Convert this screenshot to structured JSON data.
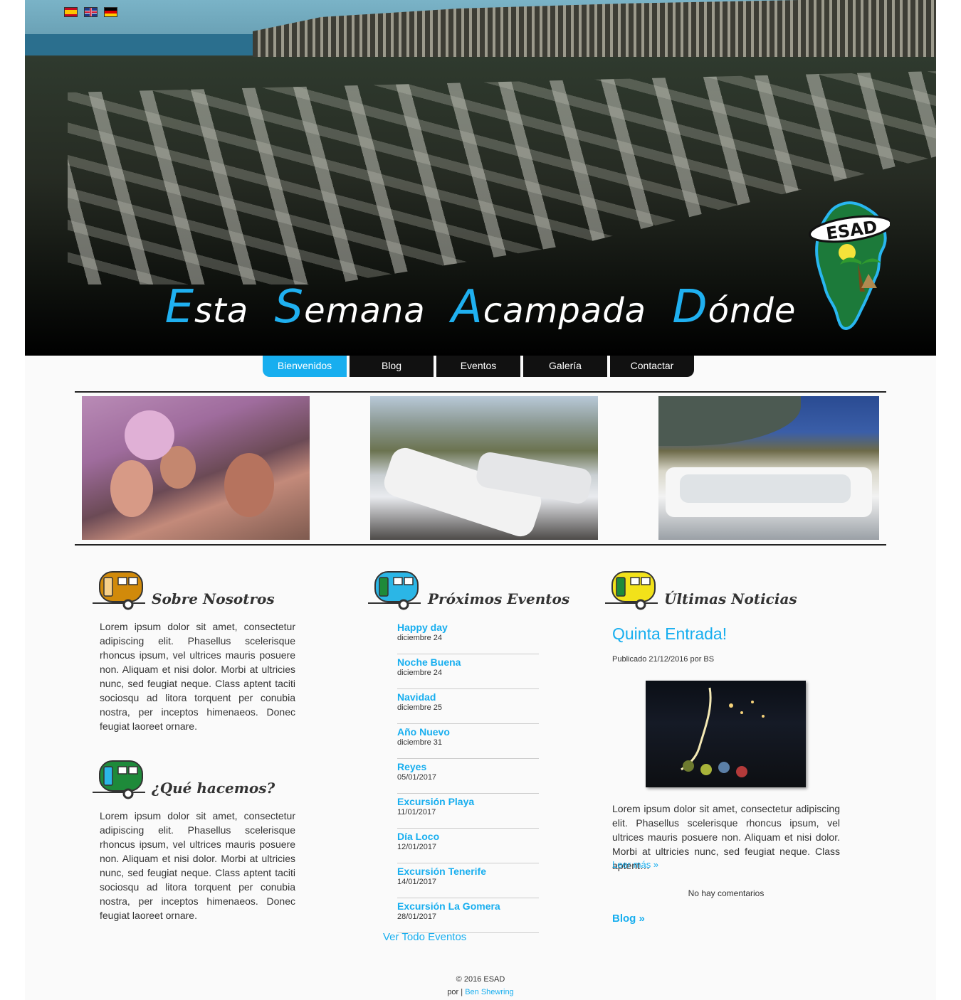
{
  "header": {
    "title_words": [
      {
        "cap": "E",
        "rest": "sta"
      },
      {
        "cap": "S",
        "rest": "emana"
      },
      {
        "cap": "A",
        "rest": "campada"
      },
      {
        "cap": "D",
        "rest": "ónde"
      }
    ],
    "logo_text": "ESAD",
    "languages": [
      "es-flag-icon",
      "gb-flag-icon",
      "de-flag-icon"
    ]
  },
  "nav": {
    "items": [
      "Bienvenidos",
      "Blog",
      "Eventos",
      "Galería",
      "Contactar"
    ],
    "active": "Bienvenidos"
  },
  "about": {
    "title": "Sobre Nosotros",
    "text": "Lorem ipsum dolor sit amet, consectetur adipiscing elit. Phasellus scelerisque rhoncus ipsum, vel ultrices mauris posuere non. Aliquam et nisi dolor. Morbi at ultricies nunc, sed feugiat neque. Class aptent taciti sociosqu ad litora torquent per conubia nostra, per inceptos himenaeos. Donec feugiat laoreet ornare."
  },
  "what": {
    "title": "¿Qué hacemos?",
    "text": "Lorem ipsum dolor sit amet, consectetur adipiscing elit. Phasellus scelerisque rhoncus ipsum, vel ultrices mauris posuere non. Aliquam et nisi dolor. Morbi at ultricies nunc, sed feugiat neque. Class aptent taciti sociosqu ad litora torquent per conubia nostra, per inceptos himenaeos. Donec feugiat laoreet ornare."
  },
  "events": {
    "title": "Próximos Eventos",
    "items": [
      {
        "title": "Happy day",
        "date": "diciembre 24"
      },
      {
        "title": "Noche Buena",
        "date": "diciembre 24"
      },
      {
        "title": "Navidad",
        "date": "diciembre 25"
      },
      {
        "title": "Año Nuevo",
        "date": "diciembre 31"
      },
      {
        "title": "Reyes",
        "date": "05/01/2017"
      },
      {
        "title": "Excursión Playa",
        "date": "11/01/2017"
      },
      {
        "title": "Día Loco",
        "date": "12/01/2017"
      },
      {
        "title": "Excursión Tenerife",
        "date": "14/01/2017"
      },
      {
        "title": "Excursión La Gomera",
        "date": "28/01/2017"
      }
    ],
    "view_all": "Ver Todo Eventos"
  },
  "news": {
    "title": "Últimas Noticias",
    "post_title": "Quinta Entrada!",
    "meta": "Publicado 21/12/2016 por BS",
    "excerpt": "Lorem ipsum dolor sit amet, consectetur adipiscing elit. Phasellus scelerisque rhoncus ipsum, vel ultrices mauris posuere non. Aliquam et nisi dolor. Morbi at ultricies nunc, sed feugiat neque. Class aptent…",
    "read_more": "Leer más »",
    "comments": "No hay comentarios",
    "blog_link": "Blog »"
  },
  "footer": {
    "copyright": "© 2016 ESAD",
    "by": "por |",
    "author": "Ben Shewring"
  },
  "colors": {
    "accent": "#17aeef",
    "nav_bg": "#111111",
    "caravan_orange": "#d18a0a",
    "caravan_blue": "#2bb6e6",
    "caravan_yellow": "#f2e21a",
    "caravan_green": "#1e8a3a"
  }
}
